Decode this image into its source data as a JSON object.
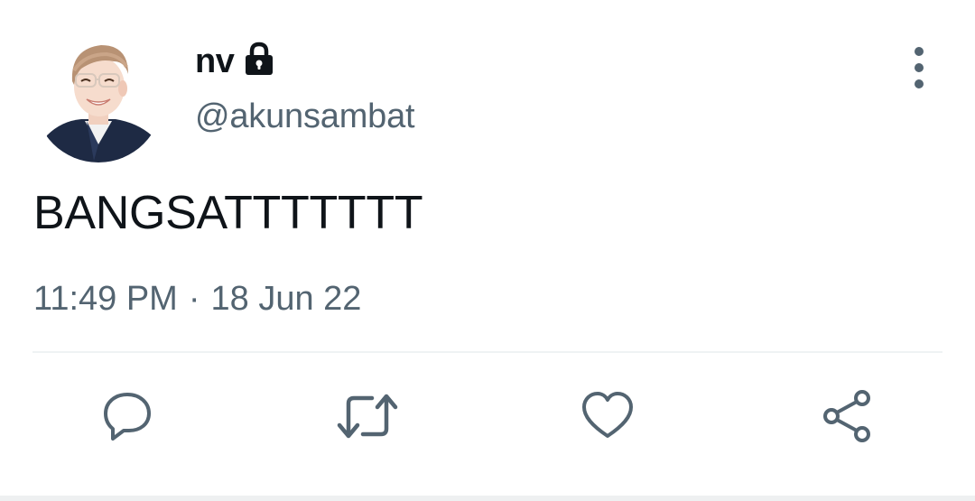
{
  "tweet": {
    "author": {
      "display_name": "nv",
      "handle": "@akunsambat",
      "locked_icon": "lock-icon",
      "avatar_icon": "profile-photo"
    },
    "text": "BANGSATTTTTTT",
    "time": "11:49 PM",
    "separator": "·",
    "date": "18 Jun 22",
    "menu_icon": "more-vertical-icon"
  },
  "actions": [
    {
      "name": "reply",
      "icon": "reply-icon"
    },
    {
      "name": "retweet",
      "icon": "retweet-icon"
    },
    {
      "name": "like",
      "icon": "heart-icon"
    },
    {
      "name": "share",
      "icon": "share-icon"
    }
  ],
  "colors": {
    "primary_text": "#0f1419",
    "secondary_text": "#536471",
    "divider": "#eff3f4",
    "background": "#ffffff"
  }
}
